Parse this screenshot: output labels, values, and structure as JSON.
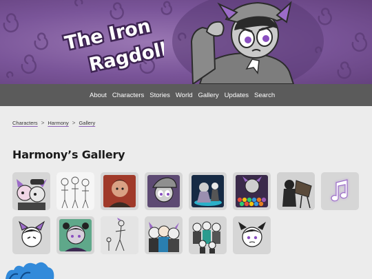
{
  "site": {
    "logo_line1": "The Iron",
    "logo_line2": "Ragdoll"
  },
  "nav": {
    "items": [
      {
        "label": "About"
      },
      {
        "label": "Characters"
      },
      {
        "label": "Stories"
      },
      {
        "label": "World"
      },
      {
        "label": "Gallery"
      },
      {
        "label": "Updates"
      },
      {
        "label": "Search"
      }
    ]
  },
  "breadcrumb": {
    "items": [
      {
        "label": "Characters"
      },
      {
        "label": "Harmony"
      },
      {
        "label": "Gallery"
      }
    ],
    "separator": ">"
  },
  "page": {
    "title": "Harmony’s Gallery"
  },
  "gallery": {
    "items": [
      {
        "icon": "harmony-duo-thumbnail"
      },
      {
        "icon": "sketch-lineup-thumbnail"
      },
      {
        "icon": "red-portrait-thumbnail"
      },
      {
        "icon": "hat-portrait-thumbnail"
      },
      {
        "icon": "blue-scene-thumbnail"
      },
      {
        "icon": "bubble-game-thumbnail"
      },
      {
        "icon": "dark-easel-thumbnail"
      },
      {
        "icon": "music-note-icon"
      },
      {
        "icon": "sticker-face-thumbnail"
      },
      {
        "icon": "green-portrait-thumbnail"
      },
      {
        "icon": "sketch-walk-thumbnail"
      },
      {
        "icon": "trio-thumbnail"
      },
      {
        "icon": "group-thumbnail"
      },
      {
        "icon": "sticker-worried-thumbnail"
      }
    ]
  },
  "colors": {
    "banner_purple": "#7a5599",
    "nav_gray": "#5b5b5b",
    "accent_purple": "#8a5db5",
    "page_bg": "#ececec",
    "thumb_bg": "#d6d6d6"
  }
}
